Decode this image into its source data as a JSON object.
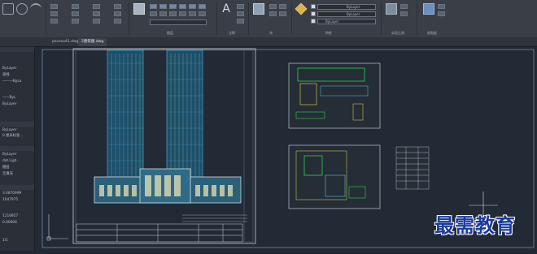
{
  "ribbon": {
    "bylayer_1": "ByLayer",
    "bylayer_2": "ByLayer",
    "bylayer_3": "ByLayer",
    "panels": [
      "图层",
      "注释",
      "块",
      "特性",
      "实用工具",
      "剪贴板"
    ]
  },
  "tabs": [
    "paceso41.dwg",
    "2建筑图.dwg"
  ],
  "palette": {
    "items": [
      "ByLayer",
      "直线",
      "———ByLa",
      "——ByL",
      "ByLayer",
      "ByLayer",
      "0 厘米标准...",
      "ByLayer",
      "dot.Ligh..",
      "随层",
      "无填充",
      "3.0870999",
      "1047975",
      "1216957",
      "0.00000",
      "1/1"
    ]
  },
  "watermark": "最需教育",
  "colors": {
    "accent": "#5fb8e0",
    "cad_green": "#2fd04a",
    "cad_yellow": "#e8d84a",
    "canvas": "#222a35"
  }
}
